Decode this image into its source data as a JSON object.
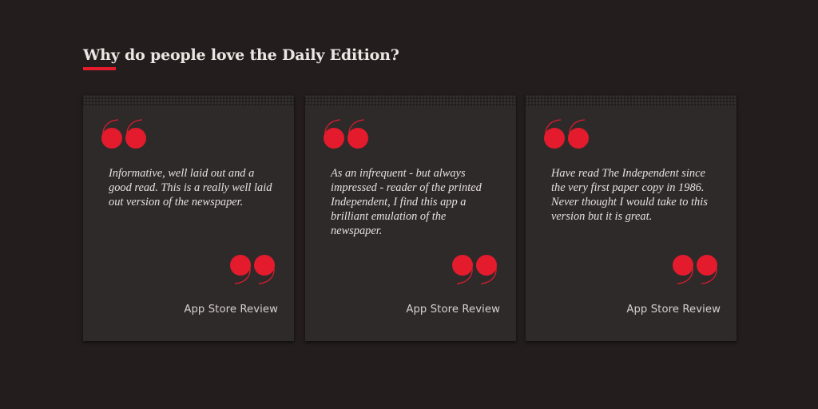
{
  "section": {
    "heading": "Why do people love the Daily Edition?"
  },
  "colors": {
    "background": "#231d1d",
    "card": "#2f2a2a",
    "accent_red": "#e31b2c",
    "heading_text": "#ece6e2",
    "body_text": "#e6e0dc"
  },
  "reviews": [
    {
      "quote": "Informative, well laid out and a good read. This is a really well laid out version of the newspaper.",
      "source": "App Store Review"
    },
    {
      "quote": "As an infrequent - but always impressed - reader of the printed Independent, I find this app a brilliant emulation of the newspaper.",
      "source": "App Store Review"
    },
    {
      "quote": "Have read The Independent since the very first paper copy in 1986. Never thought I would take to this version but it is great.",
      "source": "App Store Review"
    }
  ],
  "icons": {
    "open_quote": "quote-open-icon",
    "close_quote": "quote-close-icon"
  }
}
